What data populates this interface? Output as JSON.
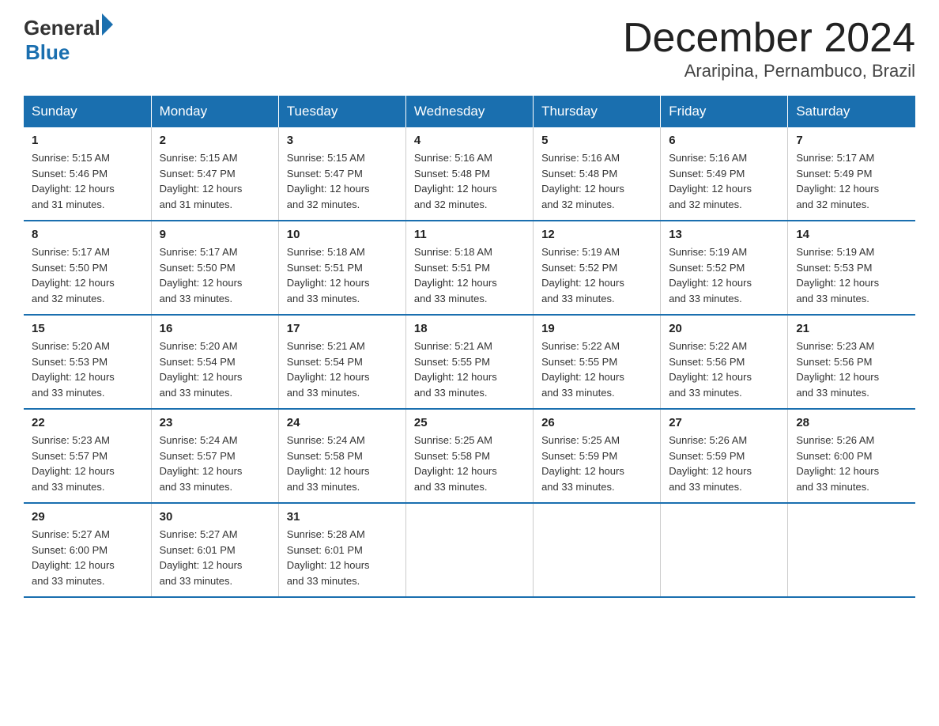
{
  "logo": {
    "general": "General",
    "triangle": "",
    "blue": "Blue"
  },
  "title": {
    "month": "December 2024",
    "location": "Araripina, Pernambuco, Brazil"
  },
  "weekdays": [
    "Sunday",
    "Monday",
    "Tuesday",
    "Wednesday",
    "Thursday",
    "Friday",
    "Saturday"
  ],
  "weeks": [
    [
      {
        "day": "1",
        "sunrise": "5:15 AM",
        "sunset": "5:46 PM",
        "daylight": "12 hours and 31 minutes."
      },
      {
        "day": "2",
        "sunrise": "5:15 AM",
        "sunset": "5:47 PM",
        "daylight": "12 hours and 31 minutes."
      },
      {
        "day": "3",
        "sunrise": "5:15 AM",
        "sunset": "5:47 PM",
        "daylight": "12 hours and 32 minutes."
      },
      {
        "day": "4",
        "sunrise": "5:16 AM",
        "sunset": "5:48 PM",
        "daylight": "12 hours and 32 minutes."
      },
      {
        "day": "5",
        "sunrise": "5:16 AM",
        "sunset": "5:48 PM",
        "daylight": "12 hours and 32 minutes."
      },
      {
        "day": "6",
        "sunrise": "5:16 AM",
        "sunset": "5:49 PM",
        "daylight": "12 hours and 32 minutes."
      },
      {
        "day": "7",
        "sunrise": "5:17 AM",
        "sunset": "5:49 PM",
        "daylight": "12 hours and 32 minutes."
      }
    ],
    [
      {
        "day": "8",
        "sunrise": "5:17 AM",
        "sunset": "5:50 PM",
        "daylight": "12 hours and 32 minutes."
      },
      {
        "day": "9",
        "sunrise": "5:17 AM",
        "sunset": "5:50 PM",
        "daylight": "12 hours and 33 minutes."
      },
      {
        "day": "10",
        "sunrise": "5:18 AM",
        "sunset": "5:51 PM",
        "daylight": "12 hours and 33 minutes."
      },
      {
        "day": "11",
        "sunrise": "5:18 AM",
        "sunset": "5:51 PM",
        "daylight": "12 hours and 33 minutes."
      },
      {
        "day": "12",
        "sunrise": "5:19 AM",
        "sunset": "5:52 PM",
        "daylight": "12 hours and 33 minutes."
      },
      {
        "day": "13",
        "sunrise": "5:19 AM",
        "sunset": "5:52 PM",
        "daylight": "12 hours and 33 minutes."
      },
      {
        "day": "14",
        "sunrise": "5:19 AM",
        "sunset": "5:53 PM",
        "daylight": "12 hours and 33 minutes."
      }
    ],
    [
      {
        "day": "15",
        "sunrise": "5:20 AM",
        "sunset": "5:53 PM",
        "daylight": "12 hours and 33 minutes."
      },
      {
        "day": "16",
        "sunrise": "5:20 AM",
        "sunset": "5:54 PM",
        "daylight": "12 hours and 33 minutes."
      },
      {
        "day": "17",
        "sunrise": "5:21 AM",
        "sunset": "5:54 PM",
        "daylight": "12 hours and 33 minutes."
      },
      {
        "day": "18",
        "sunrise": "5:21 AM",
        "sunset": "5:55 PM",
        "daylight": "12 hours and 33 minutes."
      },
      {
        "day": "19",
        "sunrise": "5:22 AM",
        "sunset": "5:55 PM",
        "daylight": "12 hours and 33 minutes."
      },
      {
        "day": "20",
        "sunrise": "5:22 AM",
        "sunset": "5:56 PM",
        "daylight": "12 hours and 33 minutes."
      },
      {
        "day": "21",
        "sunrise": "5:23 AM",
        "sunset": "5:56 PM",
        "daylight": "12 hours and 33 minutes."
      }
    ],
    [
      {
        "day": "22",
        "sunrise": "5:23 AM",
        "sunset": "5:57 PM",
        "daylight": "12 hours and 33 minutes."
      },
      {
        "day": "23",
        "sunrise": "5:24 AM",
        "sunset": "5:57 PM",
        "daylight": "12 hours and 33 minutes."
      },
      {
        "day": "24",
        "sunrise": "5:24 AM",
        "sunset": "5:58 PM",
        "daylight": "12 hours and 33 minutes."
      },
      {
        "day": "25",
        "sunrise": "5:25 AM",
        "sunset": "5:58 PM",
        "daylight": "12 hours and 33 minutes."
      },
      {
        "day": "26",
        "sunrise": "5:25 AM",
        "sunset": "5:59 PM",
        "daylight": "12 hours and 33 minutes."
      },
      {
        "day": "27",
        "sunrise": "5:26 AM",
        "sunset": "5:59 PM",
        "daylight": "12 hours and 33 minutes."
      },
      {
        "day": "28",
        "sunrise": "5:26 AM",
        "sunset": "6:00 PM",
        "daylight": "12 hours and 33 minutes."
      }
    ],
    [
      {
        "day": "29",
        "sunrise": "5:27 AM",
        "sunset": "6:00 PM",
        "daylight": "12 hours and 33 minutes."
      },
      {
        "day": "30",
        "sunrise": "5:27 AM",
        "sunset": "6:01 PM",
        "daylight": "12 hours and 33 minutes."
      },
      {
        "day": "31",
        "sunrise": "5:28 AM",
        "sunset": "6:01 PM",
        "daylight": "12 hours and 33 minutes."
      },
      null,
      null,
      null,
      null
    ]
  ],
  "labels": {
    "sunrise": "Sunrise:",
    "sunset": "Sunset:",
    "daylight": "Daylight:"
  }
}
